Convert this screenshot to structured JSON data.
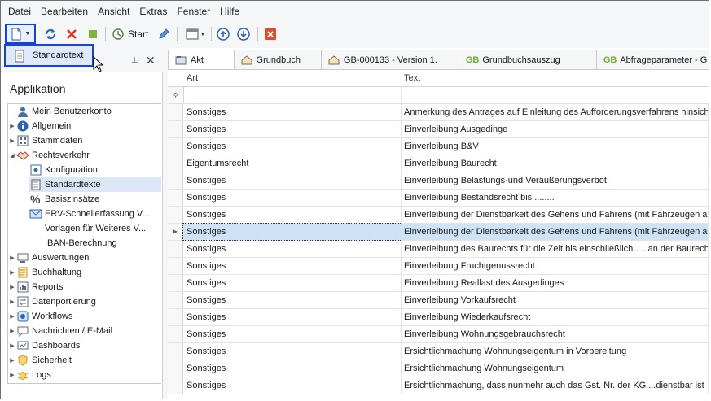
{
  "menu": [
    "Datei",
    "Bearbeiten",
    "Ansicht",
    "Extras",
    "Fenster",
    "Hilfe"
  ],
  "toolbar": {
    "start_label": "Start"
  },
  "dropdown": {
    "item": "Standardtext"
  },
  "panel": {
    "title": "Applikation"
  },
  "tree": [
    {
      "label": "Mein Benutzerkonto",
      "level": 0,
      "arrow": "",
      "icon": "user-icon",
      "color": "#4a6fa5"
    },
    {
      "label": "Allgemein",
      "level": 0,
      "arrow": "▶",
      "icon": "info-icon",
      "color": "#2a63b8"
    },
    {
      "label": "Stammdaten",
      "level": 0,
      "arrow": "▶",
      "icon": "database-icon",
      "color": "#5a6b7d"
    },
    {
      "label": "Rechtsverkehr",
      "level": 0,
      "arrow": "◢",
      "icon": "handshake-icon",
      "color": "#c0392b"
    },
    {
      "label": "Konfiguration",
      "level": 1,
      "arrow": "",
      "icon": "config-icon",
      "color": "#3a6ea5"
    },
    {
      "label": "Standardtexte",
      "level": 1,
      "arrow": "",
      "icon": "document-icon",
      "color": "#555555",
      "selected": true
    },
    {
      "label": "Basiszinsätze",
      "level": 1,
      "arrow": "",
      "icon": "percent-icon",
      "color": "#444444"
    },
    {
      "label": "ERV-Schnellerfassung V...",
      "level": 1,
      "arrow": "",
      "icon": "mail-icon",
      "color": "#2a63b8"
    },
    {
      "label": "Vorlagen für Weiteres V...",
      "level": 1,
      "arrow": "",
      "icon": "",
      "color": "#444444"
    },
    {
      "label": "IBAN-Berechnung",
      "level": 1,
      "arrow": "",
      "icon": "",
      "color": "#444444"
    },
    {
      "label": "Auswertungen",
      "level": 0,
      "arrow": "▶",
      "icon": "monitor-icon",
      "color": "#5a6b7d"
    },
    {
      "label": "Buchhaltung",
      "level": 0,
      "arrow": "▶",
      "icon": "ledger-icon",
      "color": "#c88a1a"
    },
    {
      "label": "Reports",
      "level": 0,
      "arrow": "▶",
      "icon": "report-icon",
      "color": "#5a6b7d"
    },
    {
      "label": "Datenportierung",
      "level": 0,
      "arrow": "▶",
      "icon": "transfer-icon",
      "color": "#5a6b7d"
    },
    {
      "label": "Workflows",
      "level": 0,
      "arrow": "▶",
      "icon": "workflow-icon",
      "color": "#2a63b8"
    },
    {
      "label": "Nachrichten / E-Mail",
      "level": 0,
      "arrow": "▶",
      "icon": "chat-icon",
      "color": "#5a6b7d"
    },
    {
      "label": "Dashboards",
      "level": 0,
      "arrow": "▶",
      "icon": "dashboard-icon",
      "color": "#5a6b7d"
    },
    {
      "label": "Sicherheit",
      "level": 0,
      "arrow": "▶",
      "icon": "shield-icon",
      "color": "#d49a1c"
    },
    {
      "label": "Logs",
      "level": 0,
      "arrow": "▶",
      "icon": "bug-icon",
      "color": "#d49a1c"
    }
  ],
  "tabs": [
    {
      "label": "Akt",
      "icon": "folder-icon",
      "prefix": ""
    },
    {
      "label": "Grundbuch",
      "icon": "house-icon",
      "prefix": ""
    },
    {
      "label": "GB-000133 - Version 1.",
      "icon": "house-icon",
      "prefix": ""
    },
    {
      "label": "Grundbuchsauszug",
      "icon": "",
      "prefix": "GB"
    },
    {
      "label": "Abfrageparameter - G",
      "icon": "",
      "prefix": "GB"
    }
  ],
  "grid": {
    "columns": [
      "Art",
      "Text"
    ],
    "rows": [
      [
        "Sonstiges",
        "Anmerkung des Antrages auf Einleitung des Aufforderungsverfahrens hinsichtlich"
      ],
      [
        "Sonstiges",
        "Einverleibung Ausgedinge"
      ],
      [
        "Sonstiges",
        "Einverleibung B&V"
      ],
      [
        "Eigentumsrecht",
        "Einverleibung Baurecht"
      ],
      [
        "Sonstiges",
        "Einverleibung Belastungs-und Veräußerungsverbot"
      ],
      [
        "Sonstiges",
        "Einverleibung Bestandsrecht bis ........"
      ],
      [
        "Sonstiges",
        "Einverleibung der Dienstbarkeit des Gehens und Fahrens (mit Fahrzeugen aller Art)"
      ],
      [
        "Sonstiges",
        "Einverleibung der Dienstbarkeit des Gehens und Fahrens (mit Fahrzeugen aller Art)"
      ],
      [
        "Sonstiges",
        "Einverleibung des Baurechts für die Zeit bis einschließlich .....an der Baurechtsliegenschaft"
      ],
      [
        "Sonstiges",
        "Einverleibung Fruchtgenussrecht"
      ],
      [
        "Sonstiges",
        "Einverleibung Reallast des Ausgedinges"
      ],
      [
        "Sonstiges",
        "Einverleibung Vorkaufsrecht"
      ],
      [
        "Sonstiges",
        "Einverleibung Wiederkaufsrecht"
      ],
      [
        "Sonstiges",
        "Einverleibung Wohnungsgebrauchsrecht"
      ],
      [
        "Sonstiges",
        "Ersichtlichmachung Wohnungseigentum in Vorbereitung"
      ],
      [
        "Sonstiges",
        "Ersichtlichmachung Wohnungseigentum"
      ],
      [
        "Sonstiges",
        "Ersichtlichmachung, dass nunmehr auch das Gst. Nr.  der KG....dienstbar ist"
      ]
    ],
    "selected_row": 7
  }
}
